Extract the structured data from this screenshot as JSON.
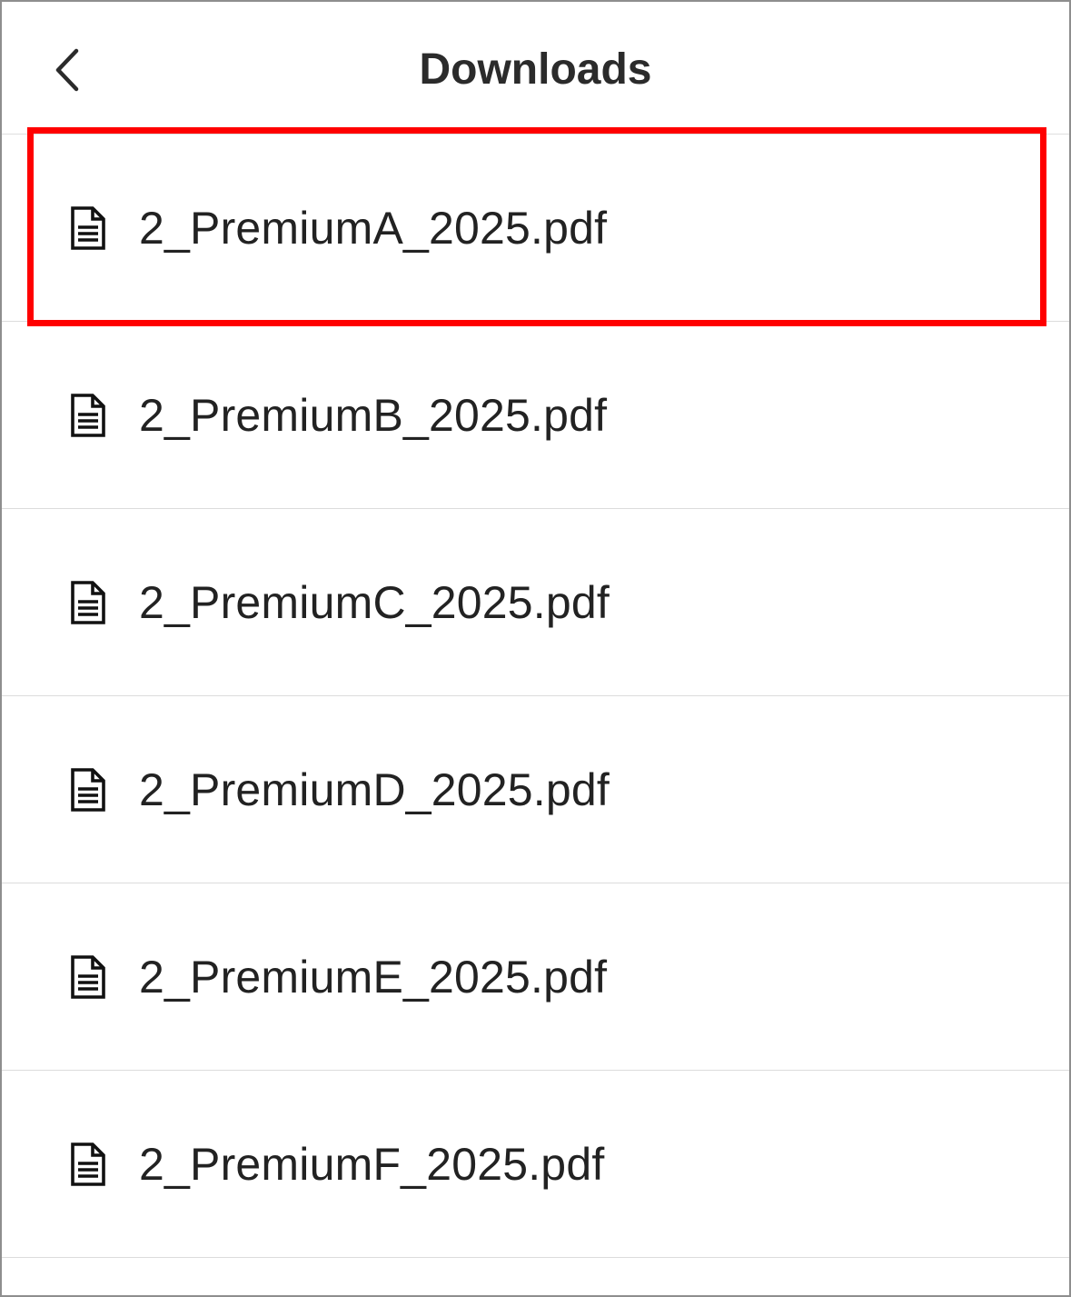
{
  "header": {
    "back_icon": "chevron-left-icon",
    "title": "Downloads"
  },
  "files": [
    {
      "name": "2_PremiumA_2025.pdf",
      "icon": "document-icon"
    },
    {
      "name": "2_PremiumB_2025.pdf",
      "icon": "document-icon"
    },
    {
      "name": "2_PremiumC_2025.pdf",
      "icon": "document-icon"
    },
    {
      "name": "2_PremiumD_2025.pdf",
      "icon": "document-icon"
    },
    {
      "name": "2_PremiumE_2025.pdf",
      "icon": "document-icon"
    },
    {
      "name": "2_PremiumF_2025.pdf",
      "icon": "document-icon"
    }
  ],
  "highlight": {
    "target": "2_PremiumA_2025.pdf",
    "color": "#ff0000"
  }
}
